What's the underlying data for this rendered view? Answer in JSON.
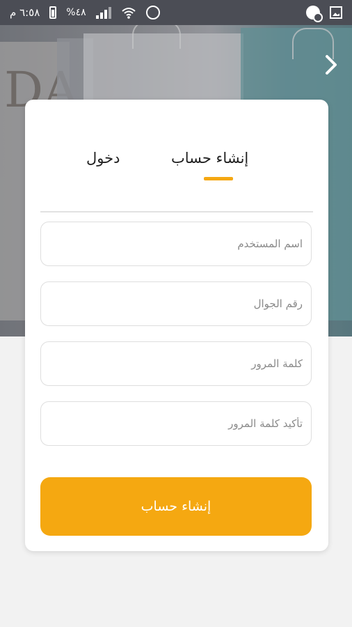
{
  "status_bar": {
    "time": "٦:٥٨ م",
    "battery": "%٤٨"
  },
  "hero": {
    "bag_letters": "DA"
  },
  "tabs": {
    "signup_label": "إنشاء حساب",
    "login_label": "دخول",
    "active": "signup"
  },
  "form": {
    "username_placeholder": "اسم المستخدم",
    "phone_placeholder": "رقم الجوال",
    "password_placeholder": "كلمة المرور",
    "confirm_password_placeholder": "تأكيد كلمة المرور",
    "submit_label": "إنشاء حساب"
  },
  "colors": {
    "accent": "#f5a811",
    "status_bar": "#4b4d55",
    "background": "#f2f2f2",
    "card": "#ffffff"
  },
  "icons": {
    "status_left": [
      "battery-icon",
      "signal-icon",
      "wifi-icon",
      "alarm-icon"
    ],
    "status_right": [
      "app-notification-icon",
      "gallery-icon"
    ],
    "nav": "chevron-right-icon"
  }
}
